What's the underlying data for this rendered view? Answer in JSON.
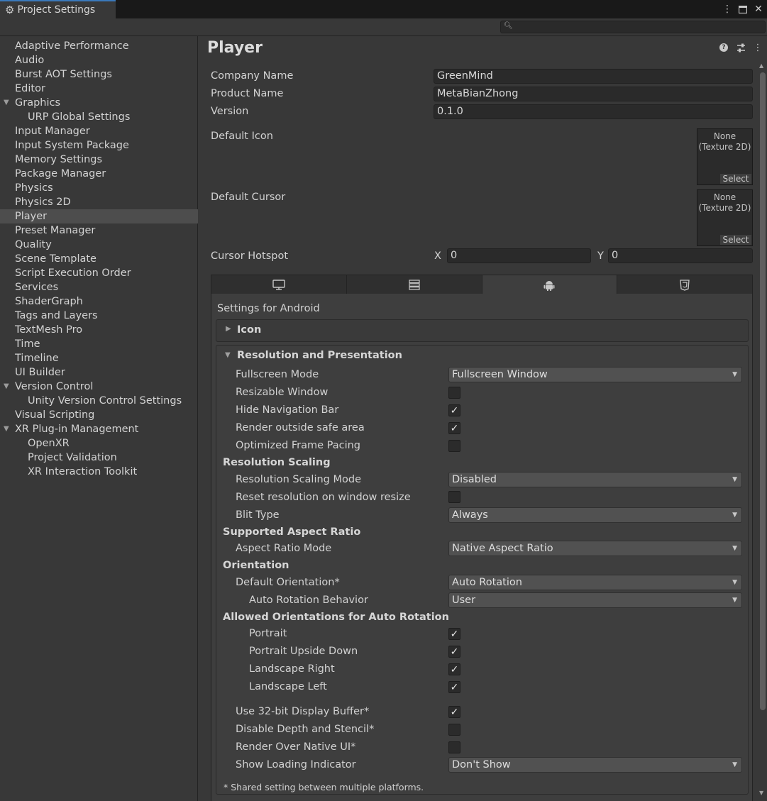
{
  "window": {
    "title": "Project Settings",
    "icons": {
      "tab": "gear-icon",
      "more": "kebab-menu-icon",
      "maximize": "maximize-icon",
      "close": "close-icon"
    }
  },
  "search": {
    "placeholder": "",
    "icon": "search-icon"
  },
  "sidebar": {
    "items": [
      {
        "label": "Adaptive Performance"
      },
      {
        "label": "Audio"
      },
      {
        "label": "Burst AOT Settings"
      },
      {
        "label": "Editor"
      },
      {
        "label": "Graphics",
        "expanded": true
      },
      {
        "label": "URP Global Settings",
        "child": true
      },
      {
        "label": "Input Manager"
      },
      {
        "label": "Input System Package"
      },
      {
        "label": "Memory Settings"
      },
      {
        "label": "Package Manager"
      },
      {
        "label": "Physics"
      },
      {
        "label": "Physics 2D"
      },
      {
        "label": "Player",
        "selected": true
      },
      {
        "label": "Preset Manager"
      },
      {
        "label": "Quality"
      },
      {
        "label": "Scene Template"
      },
      {
        "label": "Script Execution Order"
      },
      {
        "label": "Services"
      },
      {
        "label": "ShaderGraph"
      },
      {
        "label": "Tags and Layers"
      },
      {
        "label": "TextMesh Pro"
      },
      {
        "label": "Time"
      },
      {
        "label": "Timeline"
      },
      {
        "label": "UI Builder"
      },
      {
        "label": "Version Control",
        "expanded": true
      },
      {
        "label": "Unity Version Control Settings",
        "child": true
      },
      {
        "label": "Visual Scripting"
      },
      {
        "label": "XR Plug-in Management",
        "expanded": true
      },
      {
        "label": "OpenXR",
        "child": true
      },
      {
        "label": "Project Validation",
        "child": true
      },
      {
        "label": "XR Interaction Toolkit",
        "child": true
      }
    ]
  },
  "main": {
    "title": "Player",
    "header_icons": [
      "help-icon",
      "preset-icon",
      "kebab-menu-icon"
    ],
    "company_label": "Company Name",
    "company_value": "GreenMind",
    "product_label": "Product Name",
    "product_value": "MetaBianZhong",
    "version_label": "Version",
    "version_value": "0.1.0",
    "default_icon_label": "Default Icon",
    "default_cursor_label": "Default Cursor",
    "texture_none": "None",
    "texture_type": "(Texture 2D)",
    "texture_select": "Select",
    "hotspot_label": "Cursor Hotspot",
    "hotspot_x_label": "X",
    "hotspot_x": "0",
    "hotspot_y_label": "Y",
    "hotspot_y": "0",
    "platform_tabs": [
      "monitor-icon",
      "server-icon",
      "android-icon",
      "html5-icon"
    ],
    "settings_for": "Settings for Android",
    "icon_section": "Icon",
    "res_section": "Resolution and Presentation",
    "rows": {
      "fullscreen_mode": {
        "label": "Fullscreen Mode",
        "value": "Fullscreen Window"
      },
      "resizable_window": {
        "label": "Resizable Window",
        "checked": false
      },
      "hide_nav_bar": {
        "label": "Hide Navigation Bar",
        "checked": true
      },
      "render_outside_safe": {
        "label": "Render outside safe area",
        "checked": true
      },
      "optimized_frame_pacing": {
        "label": "Optimized Frame Pacing",
        "checked": false
      },
      "resolution_scaling_header": "Resolution Scaling",
      "resolution_scaling_mode": {
        "label": "Resolution Scaling Mode",
        "value": "Disabled"
      },
      "reset_resolution": {
        "label": "Reset resolution on window resize",
        "checked": false
      },
      "blit_type": {
        "label": "Blit Type",
        "value": "Always"
      },
      "aspect_header": "Supported Aspect Ratio",
      "aspect_mode": {
        "label": "Aspect Ratio Mode",
        "value": "Native Aspect Ratio"
      },
      "orientation_header": "Orientation",
      "default_orientation": {
        "label": "Default Orientation*",
        "value": "Auto Rotation"
      },
      "auto_rotation_behavior": {
        "label": "Auto Rotation Behavior",
        "value": "User"
      },
      "allowed_header": "Allowed Orientations for Auto Rotation",
      "portrait": {
        "label": "Portrait",
        "checked": true
      },
      "portrait_upside_down": {
        "label": "Portrait Upside Down",
        "checked": true
      },
      "landscape_right": {
        "label": "Landscape Right",
        "checked": true
      },
      "landscape_left": {
        "label": "Landscape Left",
        "checked": true
      },
      "display_buffer": {
        "label": "Use 32-bit Display Buffer*",
        "checked": true
      },
      "disable_depth": {
        "label": "Disable Depth and Stencil*",
        "checked": false
      },
      "render_over_native": {
        "label": "Render Over Native UI*",
        "checked": false
      },
      "loading_indicator": {
        "label": "Show Loading Indicator",
        "value": "Don't Show"
      }
    },
    "footnote": "* Shared setting between multiple platforms."
  }
}
